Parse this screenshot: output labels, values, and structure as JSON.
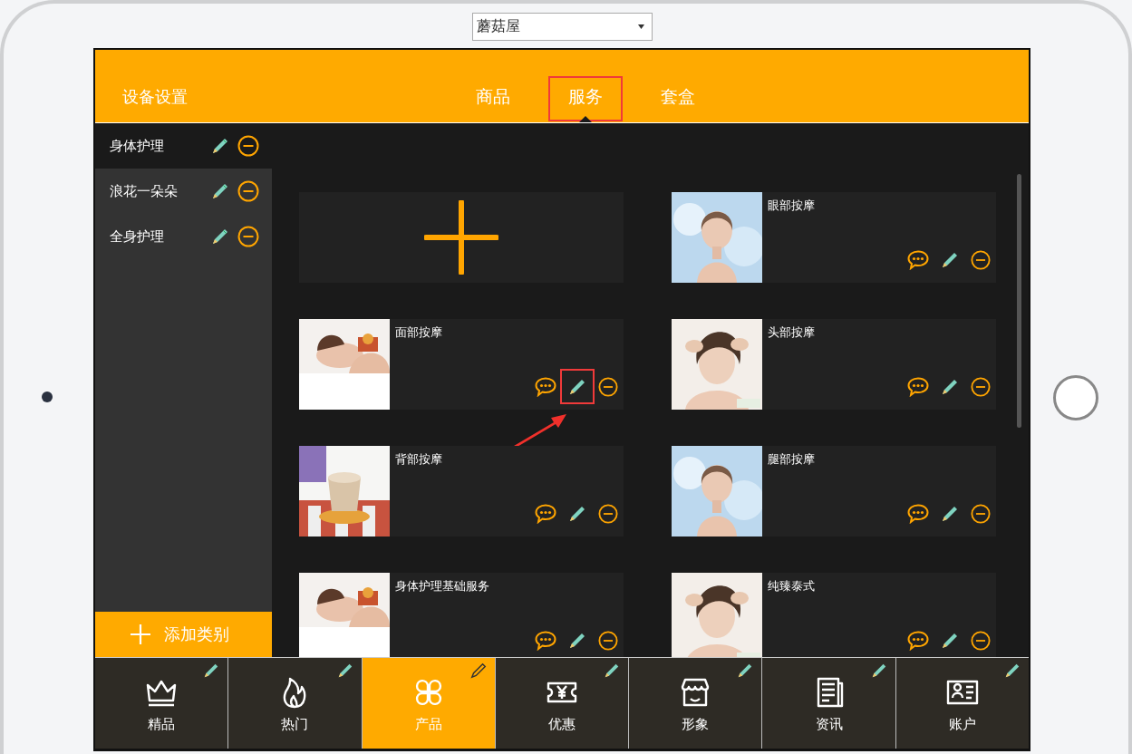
{
  "store_select": {
    "value": "蘑菇屋"
  },
  "header": {
    "title": "设备设置",
    "tabs": [
      {
        "label": "商品",
        "selected": false,
        "highlighted": false
      },
      {
        "label": "服务",
        "selected": true,
        "highlighted": true
      },
      {
        "label": "套盒",
        "selected": false,
        "highlighted": false
      }
    ]
  },
  "categories": [
    {
      "name": "身体护理",
      "selected": true
    },
    {
      "name": "浪花一朵朵",
      "selected": false
    },
    {
      "name": "全身护理",
      "selected": false
    }
  ],
  "add_category_button": {
    "label": "添加类别"
  },
  "services": [
    {
      "kind": "add"
    },
    {
      "kind": "service",
      "name": "眼部按摩",
      "edit_highlighted": false
    },
    {
      "kind": "service",
      "name": "面部按摩",
      "edit_highlighted": true
    },
    {
      "kind": "service",
      "name": "头部按摩",
      "edit_highlighted": false
    },
    {
      "kind": "service",
      "name": "背部按摩",
      "edit_highlighted": false
    },
    {
      "kind": "service",
      "name": "腿部按摩",
      "edit_highlighted": false
    },
    {
      "kind": "service",
      "name": "身体护理基础服务",
      "edit_highlighted": false
    },
    {
      "kind": "service",
      "name": "纯臻泰式",
      "edit_highlighted": false
    }
  ],
  "nav": [
    {
      "label": "精品",
      "selected": false
    },
    {
      "label": "热门",
      "selected": false
    },
    {
      "label": "产品",
      "selected": true
    },
    {
      "label": "优惠",
      "selected": false
    },
    {
      "label": "形象",
      "selected": false
    },
    {
      "label": "资讯",
      "selected": false
    },
    {
      "label": "账户",
      "selected": false
    }
  ]
}
